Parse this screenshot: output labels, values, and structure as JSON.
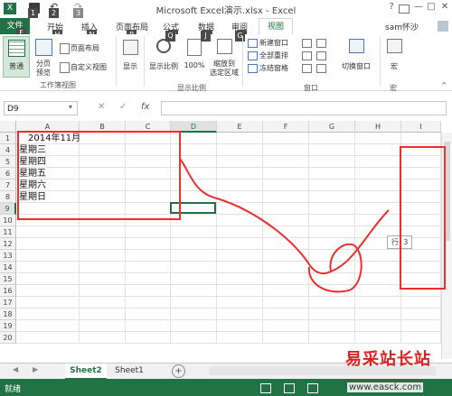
{
  "window": {
    "title": "Microsoft Excel演示.xlsx - Excel",
    "user": "sam怀沙",
    "help": "?",
    "min": "—",
    "max": "□",
    "close": "✕"
  },
  "quick_access_keytips": [
    "1",
    "2",
    "3"
  ],
  "tabs": [
    {
      "label": "文件",
      "keytip": "F"
    },
    {
      "label": "开始",
      "keytip": "H"
    },
    {
      "label": "插入",
      "keytip": "N"
    },
    {
      "label": "页面布局",
      "keytip": "P"
    },
    {
      "label": "公式",
      "keytip": "M"
    },
    {
      "label": "数据",
      "keytip": "A"
    },
    {
      "label": "审阅",
      "keytip": "R"
    },
    {
      "label": "视图",
      "keytip": "W"
    }
  ],
  "ribbon": {
    "workbook_views": {
      "normal": "普通",
      "page_break": "分页\n预览",
      "page_layout": "页面布局",
      "custom_views": "自定义视图",
      "label": "工作簿视图"
    },
    "show": "显示",
    "zoom_group": {
      "zoom": "显示比例",
      "zoom100": "100%",
      "zoom_selection": "缩放到\n选定区域",
      "label": "显示比例"
    },
    "window_group": {
      "new_window": "新建窗口",
      "arrange_all": "全部重排",
      "freeze_panes": "冻结窗格",
      "switch_windows": "切换窗口",
      "label": "窗口"
    },
    "macros": {
      "label": "宏",
      "button": "宏"
    }
  },
  "formula_bar": {
    "name_box": "D9",
    "cancel": "✕",
    "enter": "✓",
    "fx": "fx",
    "value": ""
  },
  "grid": {
    "columns": [
      "A",
      "B",
      "C",
      "D",
      "E",
      "F",
      "G",
      "H",
      "I"
    ],
    "rows": [
      "1",
      "4",
      "5",
      "6",
      "7",
      "8",
      "9",
      "10",
      "11",
      "12",
      "13",
      "14",
      "15",
      "16",
      "17",
      "18",
      "19",
      "20"
    ],
    "cells": {
      "A1": "2014年11月",
      "A4": "星期三",
      "A5": "星期四",
      "A6": "星期五",
      "A7": "星期六",
      "A8": "星期日"
    },
    "active_col": "D",
    "active_row": "9",
    "row_tooltip": "行: 3"
  },
  "sheets": {
    "tabs": [
      "Sheet2",
      "Sheet1"
    ],
    "active": "Sheet2",
    "add": "+"
  },
  "status": {
    "ready": "就绪"
  },
  "watermark": {
    "text": "易采站长站",
    "url": "www.easck.com"
  },
  "colors": {
    "excel_green": "#217346",
    "annotation_red": "#e8312f",
    "header_bg": "#f3f3f3"
  }
}
